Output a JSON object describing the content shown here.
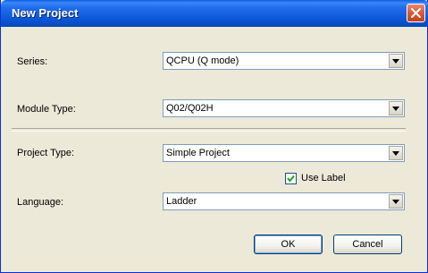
{
  "window": {
    "title": "New Project",
    "close_icon": "close-icon"
  },
  "form": {
    "series": {
      "label": "Series:",
      "value": "QCPU (Q mode)"
    },
    "module_type": {
      "label": "Module Type:",
      "value": "Q02/Q02H"
    },
    "project_type": {
      "label": "Project Type:",
      "value": "Simple Project"
    },
    "use_label": {
      "label": "Use Label",
      "checked": true
    },
    "language": {
      "label": "Language:",
      "value": "Ladder"
    }
  },
  "buttons": {
    "ok": "OK",
    "cancel": "Cancel"
  },
  "colors": {
    "titlebar": "#0b58d8",
    "dialog_bg": "#ece9d8",
    "close_button": "#d65a3a"
  }
}
